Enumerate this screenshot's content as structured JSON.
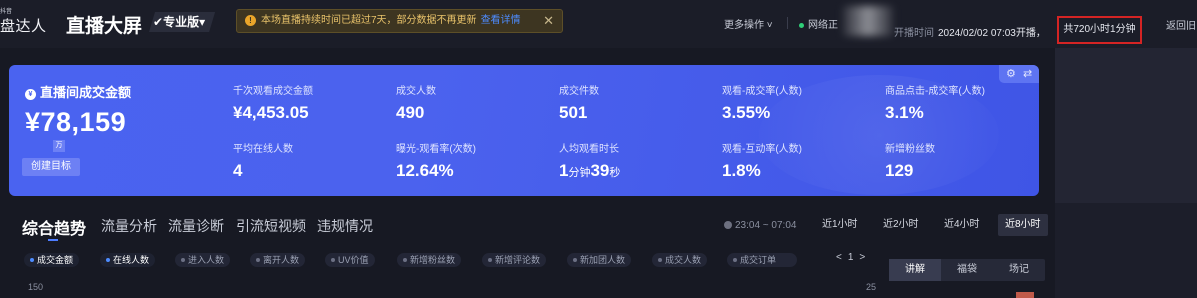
{
  "header": {
    "logo_small": "抖音",
    "logo": "盘达人",
    "title": "直播大屏",
    "edition": "专业版",
    "notice": {
      "text": "本场直播持续时间已超过7天，部分数据不再更新",
      "link": "查看详情"
    },
    "more_ops": "更多操作",
    "network": "网络正",
    "start_label": "开播时间",
    "start_value": "2024/02/02 07:03开播，",
    "duration": "共720小时1分钟",
    "back": "返回旧"
  },
  "card": {
    "gmv_label": "直播间成交金额",
    "gmv_value": "¥78,159",
    "gmv_unit": "万",
    "goal_button": "创建目标",
    "metrics": [
      {
        "label": "千次观看成交金额",
        "value": "¥4,453.05"
      },
      {
        "label": "成交人数",
        "value": "490"
      },
      {
        "label": "成交件数",
        "value": "501"
      },
      {
        "label": "观看-成交率(人数)",
        "value": "3.55%"
      },
      {
        "label": "商品点击-成交率(人数)",
        "value": "3.1%"
      },
      {
        "label": "平均在线人数",
        "value": "4"
      },
      {
        "label": "曝光-观看率(次数)",
        "value": "12.64%"
      },
      {
        "label": "人均观看时长",
        "value_min": "1",
        "min_unit": "分钟",
        "value_sec": "39",
        "sec_unit": "秒"
      },
      {
        "label": "观看-互动率(人数)",
        "value": "1.8%"
      },
      {
        "label": "新增粉丝数",
        "value": "129"
      }
    ]
  },
  "tabs": [
    "综合趋势",
    "流量分析",
    "流量诊断",
    "引流短视频",
    "违规情况"
  ],
  "time_range": "23:04 ~ 07:04",
  "time_buttons": [
    "近1小时",
    "近2小时",
    "近4小时",
    "近8小时"
  ],
  "chips": [
    "成交金额",
    "在线人数",
    "进入人数",
    "离开人数",
    "UV价值",
    "新增粉丝数",
    "新增评论数",
    "新加团人数",
    "成交人数",
    "成交订单"
  ],
  "pager": {
    "prev": "<",
    "page": "1",
    "next": ">"
  },
  "side_tabs": [
    "讲解",
    "福袋",
    "场记"
  ],
  "axis": {
    "left_top": "150",
    "right_top": "25"
  },
  "colors": {
    "accent": "#4a63f0",
    "duration_border": "#d42424",
    "notice_text": "#e8c26a",
    "link": "#4d8cff"
  }
}
